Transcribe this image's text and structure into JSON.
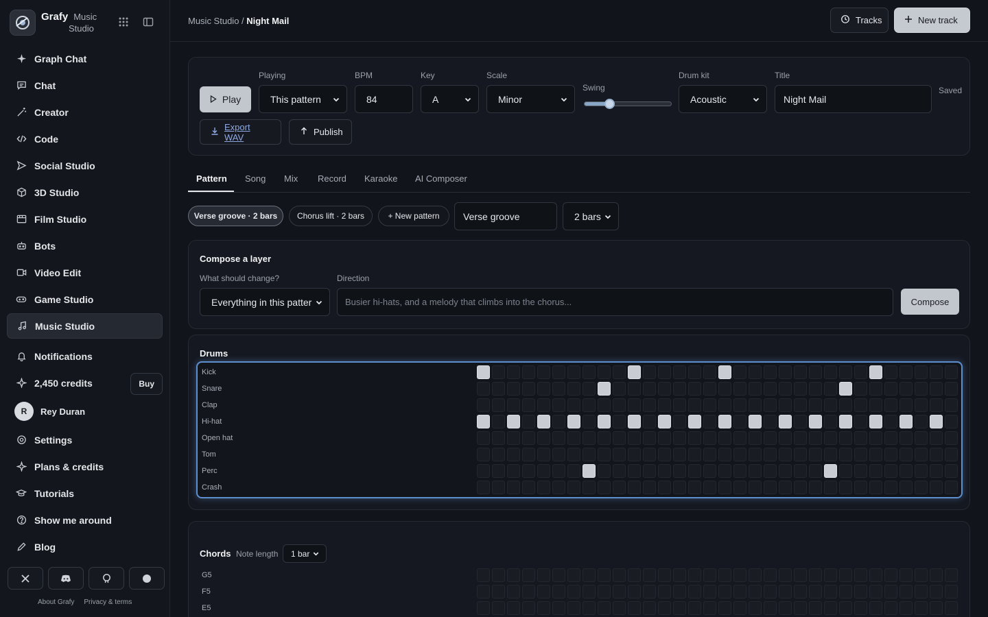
{
  "app": {
    "brand": "Grafy",
    "brand_sub_1": "Music",
    "brand_sub_2": "Studio"
  },
  "nav": [
    {
      "label": "Graph Chat",
      "icon": "sparkle-icon"
    },
    {
      "label": "Chat",
      "icon": "chat-icon"
    },
    {
      "label": "Creator",
      "icon": "wand-icon"
    },
    {
      "label": "Code",
      "icon": "code-icon"
    },
    {
      "label": "Social Studio",
      "icon": "send-icon"
    },
    {
      "label": "3D Studio",
      "icon": "cube-icon"
    },
    {
      "label": "Film Studio",
      "icon": "film-icon"
    },
    {
      "label": "Bots",
      "icon": "bot-icon"
    },
    {
      "label": "Video Edit",
      "icon": "video-icon"
    },
    {
      "label": "Game Studio",
      "icon": "gamepad-icon"
    },
    {
      "label": "Music Studio",
      "icon": "music-note-icon",
      "active": true
    }
  ],
  "bottom": {
    "notifications": "Notifications",
    "credits": "2,450 credits",
    "buy": "Buy",
    "user_initial": "R",
    "user_name": "Rey Duran",
    "settings": "Settings",
    "plans": "Plans & credits",
    "tutorials": "Tutorials",
    "show_around": "Show me around",
    "blog": "Blog",
    "about": "About Grafy",
    "privacy": "Privacy & terms"
  },
  "header": {
    "crumb_root": "Music Studio",
    "crumb_sep": " / ",
    "crumb_current": "Night Mail",
    "tracks": "Tracks",
    "new_track": "New track"
  },
  "controls": {
    "play": "Play",
    "playing_label": "Playing",
    "playing_value": "This pattern",
    "bpm_label": "BPM",
    "bpm_value": "84",
    "key_label": "Key",
    "key_value": "A",
    "scale_label": "Scale",
    "scale_value": "Minor",
    "swing_label": "Swing",
    "swing_value": 0.28,
    "drumkit_label": "Drum kit",
    "drumkit_value": "Acoustic",
    "title_label": "Title",
    "title_value": "Night Mail",
    "saved": "Saved",
    "export": "Export WAV",
    "publish": "Publish"
  },
  "tabs": [
    "Pattern",
    "Song",
    "Mix",
    "Record",
    "Karaoke",
    "AI Composer"
  ],
  "patterns": {
    "items": [
      "Verse groove · 2 bars",
      "Chorus lift · 2 bars",
      "+ New pattern"
    ],
    "name_value": "Verse groove",
    "bars_value": "2 bars"
  },
  "compose": {
    "title": "Compose a layer",
    "what_label": "What should change?",
    "what_value": "Everything in this patter",
    "direction_label": "Direction",
    "direction_placeholder": "Busier hi-hats, and a melody that climbs into the chorus...",
    "button": "Compose"
  },
  "drums": {
    "title": "Drums",
    "steps": 32,
    "rows": [
      {
        "name": "Kick",
        "on": [
          0,
          10,
          16,
          26
        ]
      },
      {
        "name": "Snare",
        "on": [
          8,
          24
        ]
      },
      {
        "name": "Clap",
        "on": []
      },
      {
        "name": "Hi-hat",
        "on": [
          0,
          2,
          4,
          6,
          8,
          10,
          12,
          14,
          16,
          18,
          20,
          22,
          24,
          26,
          28,
          30
        ]
      },
      {
        "name": "Open hat",
        "on": []
      },
      {
        "name": "Tom",
        "on": []
      },
      {
        "name": "Perc",
        "on": [
          7,
          23
        ]
      },
      {
        "name": "Crash",
        "on": []
      }
    ]
  },
  "chords": {
    "title": "Chords",
    "note_length_label": "Note length",
    "note_length_value": "1 bar",
    "rows": [
      "G5",
      "F5",
      "E5"
    ]
  }
}
